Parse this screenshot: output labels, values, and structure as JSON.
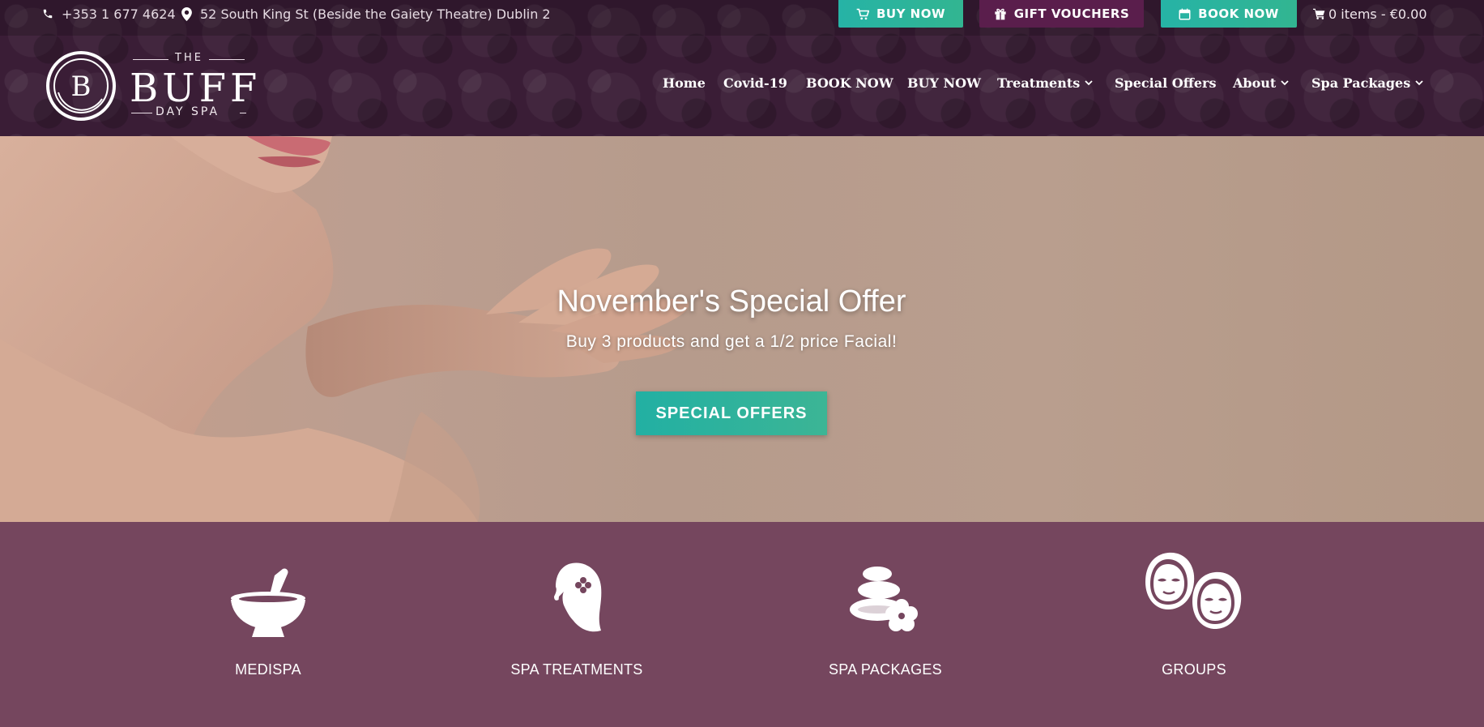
{
  "topbar": {
    "phone": "+353 1 677 4624",
    "address": "52 South King St (Beside the Gaiety Theatre) Dublin 2",
    "buttons": [
      {
        "label": "BUY NOW",
        "icon": "cart-icon",
        "color": "#2bb3a0"
      },
      {
        "label": "GIFT VOUCHERS",
        "icon": "gift-icon",
        "color": "#5a1e4c"
      },
      {
        "label": "BOOK NOW",
        "icon": "calendar-icon",
        "color": "#2bb3a0"
      }
    ],
    "cart": "0 items - €0.00"
  },
  "logo": {
    "the": "THE",
    "name": "BUFF",
    "subtitle": "DAY SPA",
    "monogram": "B"
  },
  "nav": {
    "items": [
      {
        "label": "Home"
      },
      {
        "label": "Covid-19"
      },
      {
        "label": "BOOK NOW"
      },
      {
        "label": "BUY NOW"
      },
      {
        "label": "Treatments",
        "dropdown": true
      },
      {
        "label": "Special Offers"
      },
      {
        "label": "About",
        "dropdown": true
      },
      {
        "label": "Spa Packages",
        "dropdown": true
      }
    ]
  },
  "hero": {
    "title": "November's Special Offer",
    "subtitle": "Buy 3 products and get a 1/2 price Facial!",
    "button": "SPECIAL OFFERS"
  },
  "features": [
    {
      "label": "MEDISPA",
      "icon": "mortar-pestle-icon"
    },
    {
      "label": "SPA TREATMENTS",
      "icon": "woman-flower-icon"
    },
    {
      "label": "SPA PACKAGES",
      "icon": "spa-stones-icon"
    },
    {
      "label": "GROUPS",
      "icon": "face-mask-group-icon"
    }
  ],
  "colors": {
    "header_bg": "#3a1d36",
    "accent_teal": "#2bb3a0",
    "accent_plum": "#5a1e4c",
    "features_bg": "#75465e"
  }
}
